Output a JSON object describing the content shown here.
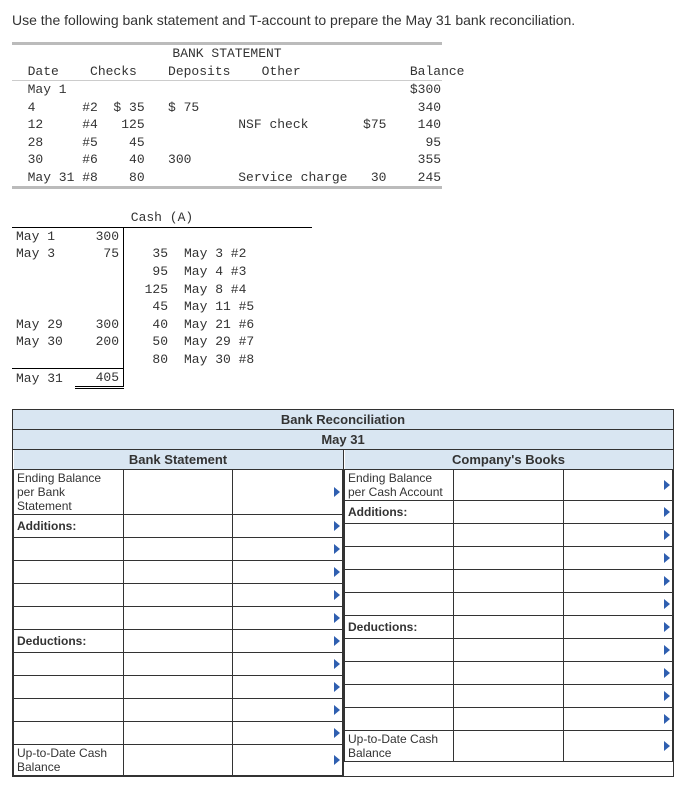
{
  "prompt": "Use the following bank statement and T-account to prepare the May 31 bank reconciliation.",
  "bank_statement": {
    "title": "BANK STATEMENT",
    "headers": {
      "date": "Date",
      "checks": "Checks",
      "deposits": "Deposits",
      "other": "Other",
      "balance": "Balance"
    },
    "rows": [
      {
        "date": "May 1",
        "checks": "",
        "amt": "",
        "deposits": "",
        "other": "",
        "oth_amt": "",
        "balance": "$300"
      },
      {
        "date": "4",
        "checks": "#2",
        "amt": "$ 35",
        "deposits": "$ 75",
        "other": "",
        "oth_amt": "",
        "balance": "340"
      },
      {
        "date": "12",
        "checks": "#4",
        "amt": "125",
        "deposits": "",
        "other": "NSF check",
        "oth_amt": "$75",
        "balance": "140"
      },
      {
        "date": "28",
        "checks": "#5",
        "amt": "45",
        "deposits": "",
        "other": "",
        "oth_amt": "",
        "balance": "95"
      },
      {
        "date": "30",
        "checks": "#6",
        "amt": "40",
        "deposits": "300",
        "other": "",
        "oth_amt": "",
        "balance": "355"
      },
      {
        "date": "May 31",
        "checks": "#8",
        "amt": "80",
        "deposits": "",
        "other": "Service charge",
        "oth_amt": "30",
        "balance": "245"
      }
    ]
  },
  "t_account": {
    "title": "Cash (A)",
    "debits": [
      {
        "date": "May 1",
        "amt": "300"
      },
      {
        "date": "May 3",
        "amt": "75"
      },
      {
        "date": "",
        "amt": ""
      },
      {
        "date": "",
        "amt": ""
      },
      {
        "date": "",
        "amt": ""
      },
      {
        "date": "May 29",
        "amt": "300"
      },
      {
        "date": "May 30",
        "amt": "200"
      }
    ],
    "credits": [
      {
        "amt": "",
        "date": ""
      },
      {
        "amt": "35",
        "date": "May 3 #2"
      },
      {
        "amt": "95",
        "date": "May 4 #3"
      },
      {
        "amt": "125",
        "date": "May 8 #4"
      },
      {
        "amt": "45",
        "date": "May 11 #5"
      },
      {
        "amt": "40",
        "date": "May 21 #6"
      },
      {
        "amt": "50",
        "date": "May 29 #7"
      },
      {
        "amt": "80",
        "date": "May 30 #8"
      }
    ],
    "balance": {
      "date": "May 31",
      "amt": "405"
    }
  },
  "recon": {
    "title": "Bank Reconciliation",
    "date": "May 31",
    "left": {
      "header": "Bank Statement",
      "ending_label": "Ending Balance per Bank Statement",
      "additions_label": "Additions:",
      "deductions_label": "Deductions:",
      "utd_label": "Up-to-Date Cash Balance"
    },
    "right": {
      "header": "Company's Books",
      "ending_label": "Ending Balance per Cash Account",
      "additions_label": "Additions:",
      "deductions_label": "Deductions:",
      "utd_label": "Up-to-Date Cash Balance"
    }
  },
  "chart_data": {
    "type": "table",
    "bank_statement_rows": [
      [
        "May 1",
        "",
        "",
        "",
        "",
        "",
        "$300"
      ],
      [
        "4",
        "#2",
        "$ 35",
        "$ 75",
        "",
        "",
        "340"
      ],
      [
        "12",
        "#4",
        "125",
        "",
        "NSF check",
        "$75",
        "140"
      ],
      [
        "28",
        "#5",
        "45",
        "",
        "",
        "",
        "95"
      ],
      [
        "30",
        "#6",
        "40",
        "300",
        "",
        "",
        "355"
      ],
      [
        "May 31",
        "#8",
        "80",
        "",
        "Service charge",
        "30",
        "245"
      ]
    ],
    "cash_t_account": {
      "debits": [
        [
          "May 1",
          300
        ],
        [
          "May 3",
          75
        ],
        [
          "May 29",
          300
        ],
        [
          "May 30",
          200
        ]
      ],
      "credits": [
        [
          "May 3 #2",
          35
        ],
        [
          "May 4 #3",
          95
        ],
        [
          "May 8 #4",
          125
        ],
        [
          "May 11 #5",
          45
        ],
        [
          "May 21 #6",
          40
        ],
        [
          "May 29 #7",
          50
        ],
        [
          "May 30 #8",
          80
        ]
      ],
      "ending_balance": [
        "May 31",
        405
      ]
    }
  }
}
